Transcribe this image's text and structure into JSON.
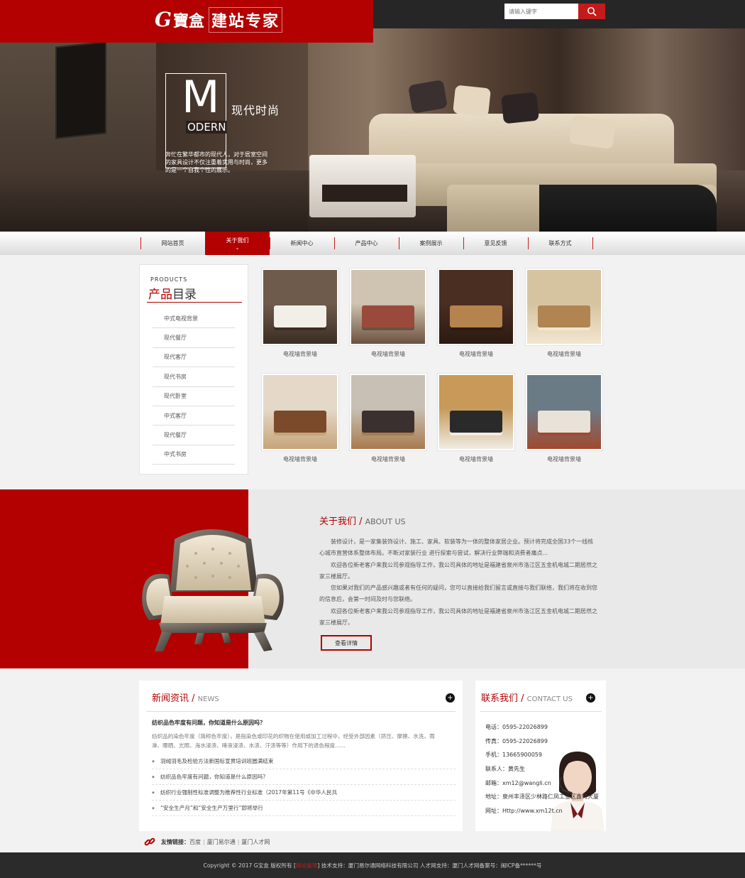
{
  "header": {
    "logo_g": "G",
    "logo_bao": "寶盒",
    "logo_slogan": "建站专家",
    "search_placeholder": "请输入键字"
  },
  "banner": {
    "big_letter": "M",
    "odern": "ODERN",
    "title_cn": "现代时尚",
    "desc": "奔忙在繁华都市的现代人，对于居室空间的家具设计不仅注重着实用与时尚，更多的是一个自我个性的展示。"
  },
  "nav": {
    "items": [
      "网站首页",
      "关于我们",
      "新闻中心",
      "产品中心",
      "案例展示",
      "意见反馈",
      "联系方式"
    ],
    "active_index": 1
  },
  "products": {
    "en_title": "PRODUCTS",
    "cn_title_red": "产品",
    "cn_title_rest": "目录",
    "categories": [
      "中式电视背景",
      "现代餐厅",
      "现代客厅",
      "现代书房",
      "现代卧室",
      "中式客厅",
      "现代餐厅",
      "中式书房"
    ],
    "items": [
      "电视墙背景墙",
      "电视墙背景墙",
      "电视墙背景墙",
      "电视墙背景墙",
      "电视墙背景墙",
      "电视墙背景墙",
      "电视墙背景墙",
      "电视墙背景墙"
    ]
  },
  "about": {
    "title_cn": "关于我们 /",
    "title_en": "ABOUT US",
    "paragraphs": [
      "装修设计，是一家集装饰设计、施工、家具、软装等为一体的整体家居企业。预计将完成全国33个一线核心城市直营体系整体布局。不断对家装行业 进行探索与尝试，解决行业弊端和消费者痛点...",
      "欢迎各位新老客户来我公司参观指导工作，我公司具体的地址是福建省泉州市洛江区五金机电城二期居然之家三楼展厅。",
      "您如果对我们的产品感兴趣或者有任何的疑问，您可以直接给我们留言或直接与我们联络，我们将在收到您的信息后，会第一时间及时与您联络。",
      "欢迎各位新老客户来我公司参观指导工作，我公司具体的地址是福建省泉州市洛江区五金机电城二期居然之家三楼展厅。"
    ],
    "more_label": "查看详情"
  },
  "news": {
    "title_cn": "新闻资讯 /",
    "title_en": "NEWS",
    "plus": "+",
    "headline": "纺织品色牢度有问题，你知道是什么原因吗？",
    "summary": "纺织品的染色牢度（简称色牢度），是指染色或印花的织物在使用或加工过程中，经受外部因素（挤压、摩擦、水洗、雨淋、曝晒、光照、海水浸渍、唾液浸渍、水渍、汗渍等等）作用下的退色程度......",
    "list": [
      "羽绒羽毛及检验方法新国标宣贯培训班圆满结束",
      "纺织品色牢度有问题，你知道是什么原因吗？",
      "纺织行业强制性标准调整为推荐性行业标准（2017年第11号《中华人民共",
      "“安全生产月”和“安全生产万里行”即将举行"
    ]
  },
  "contact": {
    "title_cn": "联系我们 /",
    "title_en": "CONTACT US",
    "plus": "+",
    "rows": [
      "电话：0595-22026899",
      "传真：0595-22026899",
      "手机：13665900059",
      "联系人：黄先生",
      "邮箱：xm12@wangli.cn",
      "地址：泉州丰泽区少林路仁凤工业区鑫特大厦",
      "网址：Http://www.xm12t.cn"
    ]
  },
  "links": {
    "label": "友情链接：",
    "items": [
      "百度",
      "厦门易尔通",
      "厦门人才网"
    ]
  },
  "footer": {
    "copyright": "Copyright © 2017 G宝盒 版权所有 [",
    "admin": "网站管理",
    "rest": "]  技术支持：厦门易尔通网络科技有限公司  人才网支持：厦门人才网备案号：闽ICP备******号"
  },
  "colors": {
    "brand_red": "#b30000",
    "dark": "#262626"
  }
}
